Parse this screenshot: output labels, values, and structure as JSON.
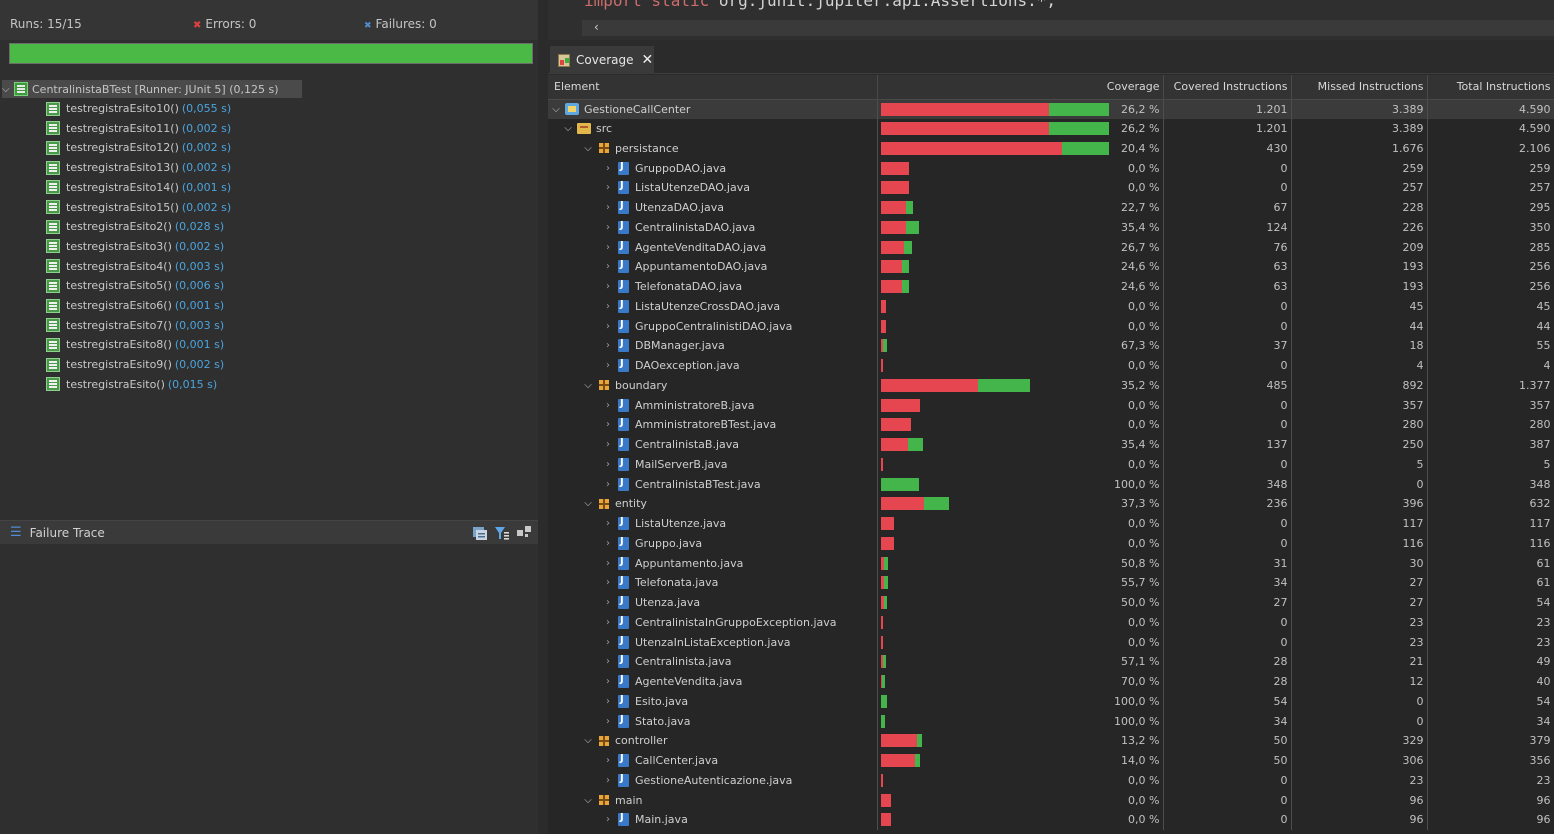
{
  "junit": {
    "runs": "Runs:  15/15",
    "errors": "Errors:  0",
    "failures": "Failures:  0",
    "root_label": "CentralinistaBTest [Runner: JUnit 5] (0,125 s)",
    "tests": [
      {
        "name": "testregistraEsito10()",
        "time": "(0,055 s)"
      },
      {
        "name": "testregistraEsito11()",
        "time": "(0,002 s)"
      },
      {
        "name": "testregistraEsito12()",
        "time": "(0,002 s)"
      },
      {
        "name": "testregistraEsito13()",
        "time": "(0,002 s)"
      },
      {
        "name": "testregistraEsito14()",
        "time": "(0,001 s)"
      },
      {
        "name": "testregistraEsito15()",
        "time": "(0,002 s)"
      },
      {
        "name": "testregistraEsito2()",
        "time": "(0,028 s)"
      },
      {
        "name": "testregistraEsito3()",
        "time": "(0,002 s)"
      },
      {
        "name": "testregistraEsito4()",
        "time": "(0,003 s)"
      },
      {
        "name": "testregistraEsito5()",
        "time": "(0,006 s)"
      },
      {
        "name": "testregistraEsito6()",
        "time": "(0,001 s)"
      },
      {
        "name": "testregistraEsito7()",
        "time": "(0,003 s)"
      },
      {
        "name": "testregistraEsito8()",
        "time": "(0,001 s)"
      },
      {
        "name": "testregistraEsito9()",
        "time": "(0,002 s)"
      },
      {
        "name": "testregistraEsito()",
        "time": "(0,015 s)"
      }
    ],
    "failure_trace_title": "Failure Trace"
  },
  "editor": {
    "code_keyword": "import static",
    "code_rest": " org.junit.jupiter.api.Assertions.*;"
  },
  "coverage": {
    "tab_label": "Coverage",
    "columns": [
      "Element",
      "Coverage",
      "Covered Instructions",
      "Missed Instructions",
      "Total Instructions"
    ],
    "rows": [
      {
        "name": "GestioneCallCenter",
        "kind": "project",
        "level": 0,
        "open": true,
        "coverage": "26,2 %",
        "covered": "1.201",
        "missed": "3.389",
        "total": "4.590",
        "c": 1201,
        "m": 3389
      },
      {
        "name": "src",
        "kind": "src",
        "level": 1,
        "open": true,
        "coverage": "26,2 %",
        "covered": "1.201",
        "missed": "3.389",
        "total": "4.590",
        "c": 1201,
        "m": 3389
      },
      {
        "name": "persistance",
        "kind": "pkg",
        "level": 2,
        "open": true,
        "coverage": "20,4 %",
        "covered": "430",
        "missed": "1.676",
        "total": "2.106",
        "c": 430,
        "m": 1676
      },
      {
        "name": "GruppoDAO.java",
        "kind": "java",
        "level": 3,
        "open": false,
        "coverage": "0,0 %",
        "covered": "0",
        "missed": "259",
        "total": "259",
        "c": 0,
        "m": 259
      },
      {
        "name": "ListaUtenzeDAO.java",
        "kind": "java",
        "level": 3,
        "open": false,
        "coverage": "0,0 %",
        "covered": "0",
        "missed": "257",
        "total": "257",
        "c": 0,
        "m": 257
      },
      {
        "name": "UtenzaDAO.java",
        "kind": "java",
        "level": 3,
        "open": false,
        "coverage": "22,7 %",
        "covered": "67",
        "missed": "228",
        "total": "295",
        "c": 67,
        "m": 228
      },
      {
        "name": "CentralinistaDAO.java",
        "kind": "java",
        "level": 3,
        "open": false,
        "coverage": "35,4 %",
        "covered": "124",
        "missed": "226",
        "total": "350",
        "c": 124,
        "m": 226
      },
      {
        "name": "AgenteVenditaDAO.java",
        "kind": "java",
        "level": 3,
        "open": false,
        "coverage": "26,7 %",
        "covered": "76",
        "missed": "209",
        "total": "285",
        "c": 76,
        "m": 209
      },
      {
        "name": "AppuntamentoDAO.java",
        "kind": "java",
        "level": 3,
        "open": false,
        "coverage": "24,6 %",
        "covered": "63",
        "missed": "193",
        "total": "256",
        "c": 63,
        "m": 193
      },
      {
        "name": "TelefonataDAO.java",
        "kind": "java",
        "level": 3,
        "open": false,
        "coverage": "24,6 %",
        "covered": "63",
        "missed": "193",
        "total": "256",
        "c": 63,
        "m": 193
      },
      {
        "name": "ListaUtenzeCrossDAO.java",
        "kind": "java",
        "level": 3,
        "open": false,
        "coverage": "0,0 %",
        "covered": "0",
        "missed": "45",
        "total": "45",
        "c": 0,
        "m": 45
      },
      {
        "name": "GruppoCentralinistiDAO.java",
        "kind": "java",
        "level": 3,
        "open": false,
        "coverage": "0,0 %",
        "covered": "0",
        "missed": "44",
        "total": "44",
        "c": 0,
        "m": 44
      },
      {
        "name": "DBManager.java",
        "kind": "java",
        "level": 3,
        "open": false,
        "coverage": "67,3 %",
        "covered": "37",
        "missed": "18",
        "total": "55",
        "c": 37,
        "m": 18
      },
      {
        "name": "DAOexception.java",
        "kind": "java",
        "level": 3,
        "open": false,
        "coverage": "0,0 %",
        "covered": "0",
        "missed": "4",
        "total": "4",
        "c": 0,
        "m": 4
      },
      {
        "name": "boundary",
        "kind": "pkg",
        "level": 2,
        "open": true,
        "coverage": "35,2 %",
        "covered": "485",
        "missed": "892",
        "total": "1.377",
        "c": 485,
        "m": 892
      },
      {
        "name": "AmministratoreB.java",
        "kind": "java",
        "level": 3,
        "open": false,
        "coverage": "0,0 %",
        "covered": "0",
        "missed": "357",
        "total": "357",
        "c": 0,
        "m": 357
      },
      {
        "name": "AmministratoreBTest.java",
        "kind": "java",
        "level": 3,
        "open": false,
        "coverage": "0,0 %",
        "covered": "0",
        "missed": "280",
        "total": "280",
        "c": 0,
        "m": 280
      },
      {
        "name": "CentralinistaB.java",
        "kind": "java",
        "level": 3,
        "open": false,
        "coverage": "35,4 %",
        "covered": "137",
        "missed": "250",
        "total": "387",
        "c": 137,
        "m": 250
      },
      {
        "name": "MailServerB.java",
        "kind": "java",
        "level": 3,
        "open": false,
        "coverage": "0,0 %",
        "covered": "0",
        "missed": "5",
        "total": "5",
        "c": 0,
        "m": 5
      },
      {
        "name": "CentralinistaBTest.java",
        "kind": "java",
        "level": 3,
        "open": false,
        "coverage": "100,0 %",
        "covered": "348",
        "missed": "0",
        "total": "348",
        "c": 348,
        "m": 0
      },
      {
        "name": "entity",
        "kind": "pkg",
        "level": 2,
        "open": true,
        "coverage": "37,3 %",
        "covered": "236",
        "missed": "396",
        "total": "632",
        "c": 236,
        "m": 396
      },
      {
        "name": "ListaUtenze.java",
        "kind": "java",
        "level": 3,
        "open": false,
        "coverage": "0,0 %",
        "covered": "0",
        "missed": "117",
        "total": "117",
        "c": 0,
        "m": 117
      },
      {
        "name": "Gruppo.java",
        "kind": "java",
        "level": 3,
        "open": false,
        "coverage": "0,0 %",
        "covered": "0",
        "missed": "116",
        "total": "116",
        "c": 0,
        "m": 116
      },
      {
        "name": "Appuntamento.java",
        "kind": "java",
        "level": 3,
        "open": false,
        "coverage": "50,8 %",
        "covered": "31",
        "missed": "30",
        "total": "61",
        "c": 31,
        "m": 30
      },
      {
        "name": "Telefonata.java",
        "kind": "java",
        "level": 3,
        "open": false,
        "coverage": "55,7 %",
        "covered": "34",
        "missed": "27",
        "total": "61",
        "c": 34,
        "m": 27
      },
      {
        "name": "Utenza.java",
        "kind": "java",
        "level": 3,
        "open": false,
        "coverage": "50,0 %",
        "covered": "27",
        "missed": "27",
        "total": "54",
        "c": 27,
        "m": 27
      },
      {
        "name": "CentralinistaInGruppoException.java",
        "kind": "java",
        "level": 3,
        "open": false,
        "coverage": "0,0 %",
        "covered": "0",
        "missed": "23",
        "total": "23",
        "c": 0,
        "m": 23
      },
      {
        "name": "UtenzaInListaException.java",
        "kind": "java",
        "level": 3,
        "open": false,
        "coverage": "0,0 %",
        "covered": "0",
        "missed": "23",
        "total": "23",
        "c": 0,
        "m": 23
      },
      {
        "name": "Centralinista.java",
        "kind": "java",
        "level": 3,
        "open": false,
        "coverage": "57,1 %",
        "covered": "28",
        "missed": "21",
        "total": "49",
        "c": 28,
        "m": 21
      },
      {
        "name": "AgenteVendita.java",
        "kind": "java",
        "level": 3,
        "open": false,
        "coverage": "70,0 %",
        "covered": "28",
        "missed": "12",
        "total": "40",
        "c": 28,
        "m": 12
      },
      {
        "name": "Esito.java",
        "kind": "java",
        "level": 3,
        "open": false,
        "coverage": "100,0 %",
        "covered": "54",
        "missed": "0",
        "total": "54",
        "c": 54,
        "m": 0
      },
      {
        "name": "Stato.java",
        "kind": "java",
        "level": 3,
        "open": false,
        "coverage": "100,0 %",
        "covered": "34",
        "missed": "0",
        "total": "34",
        "c": 34,
        "m": 0
      },
      {
        "name": "controller",
        "kind": "pkg",
        "level": 2,
        "open": true,
        "coverage": "13,2 %",
        "covered": "50",
        "missed": "329",
        "total": "379",
        "c": 50,
        "m": 329
      },
      {
        "name": "CallCenter.java",
        "kind": "java",
        "level": 3,
        "open": false,
        "coverage": "14,0 %",
        "covered": "50",
        "missed": "306",
        "total": "356",
        "c": 50,
        "m": 306
      },
      {
        "name": "GestioneAutenticazione.java",
        "kind": "java",
        "level": 3,
        "open": false,
        "coverage": "0,0 %",
        "covered": "0",
        "missed": "23",
        "total": "23",
        "c": 0,
        "m": 23
      },
      {
        "name": "main",
        "kind": "pkg",
        "level": 2,
        "open": true,
        "coverage": "0,0 %",
        "covered": "0",
        "missed": "96",
        "total": "96",
        "c": 0,
        "m": 96
      },
      {
        "name": "Main.java",
        "kind": "java",
        "level": 3,
        "open": false,
        "coverage": "0,0 %",
        "covered": "0",
        "missed": "96",
        "total": "96",
        "c": 0,
        "m": 96
      }
    ]
  },
  "colors": {
    "missed": "#e5464f",
    "covered": "#44b54a",
    "progress": "#4ab946"
  }
}
